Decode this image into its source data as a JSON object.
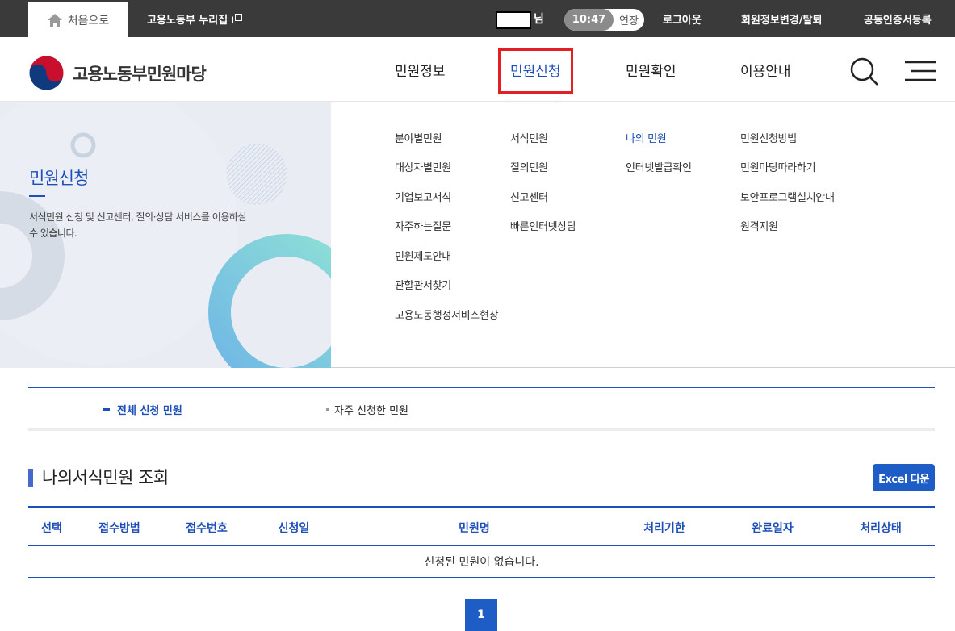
{
  "topbar": {
    "home_label": "처음으로",
    "nurijip_label": "고용노동부 누리집",
    "user_suffix": "님",
    "timer_value": "10:47",
    "extend_label": "연장",
    "links": [
      "로그아웃",
      "회원정보변경/탈퇴",
      "공동인증서등록"
    ]
  },
  "header": {
    "logo_text": "고용노동부민원마당",
    "nav": [
      "민원정보",
      "민원신청",
      "민원확인",
      "이용안내"
    ],
    "active_nav": "민원신청"
  },
  "mega": {
    "promo_title": "민원신청",
    "promo_desc": "서식민원 신청 및 신고센터, 질의·상담 서비스를 이용하실 수 있습니다.",
    "columns": [
      [
        "분야별민원",
        "대상자별민원",
        "기업보고서식",
        "자주하는질문",
        "민원제도안내",
        "관할관서찾기",
        "고용노동행정서비스현장"
      ],
      [
        "서식민원",
        "질의민원",
        "신고센터",
        "빠른인터넷상담"
      ],
      [
        "나의 민원",
        "인터넷발급확인"
      ],
      [
        "민원신청방법",
        "민원마당따라하기",
        "보안프로그램설치안내",
        "원격지원"
      ]
    ],
    "current_item": "나의 민원"
  },
  "subtabs": {
    "active": "전체 신청 민원",
    "other": "자주 신청한 민원"
  },
  "section": {
    "title": "나의서식민원 조회",
    "excel_label": "Excel 다운"
  },
  "table": {
    "headers": [
      "선택",
      "접수방법",
      "접수번호",
      "신청일",
      "민원명",
      "처리기한",
      "완료일자",
      "처리상태"
    ],
    "empty_message": "신청된 민원이 없습니다."
  },
  "pagination": {
    "current_page": "1"
  },
  "colors": {
    "primary": "#1e4fb8",
    "highlight": "#e31e24",
    "topbar": "#3a3a3a",
    "button": "#1e5cc6"
  }
}
